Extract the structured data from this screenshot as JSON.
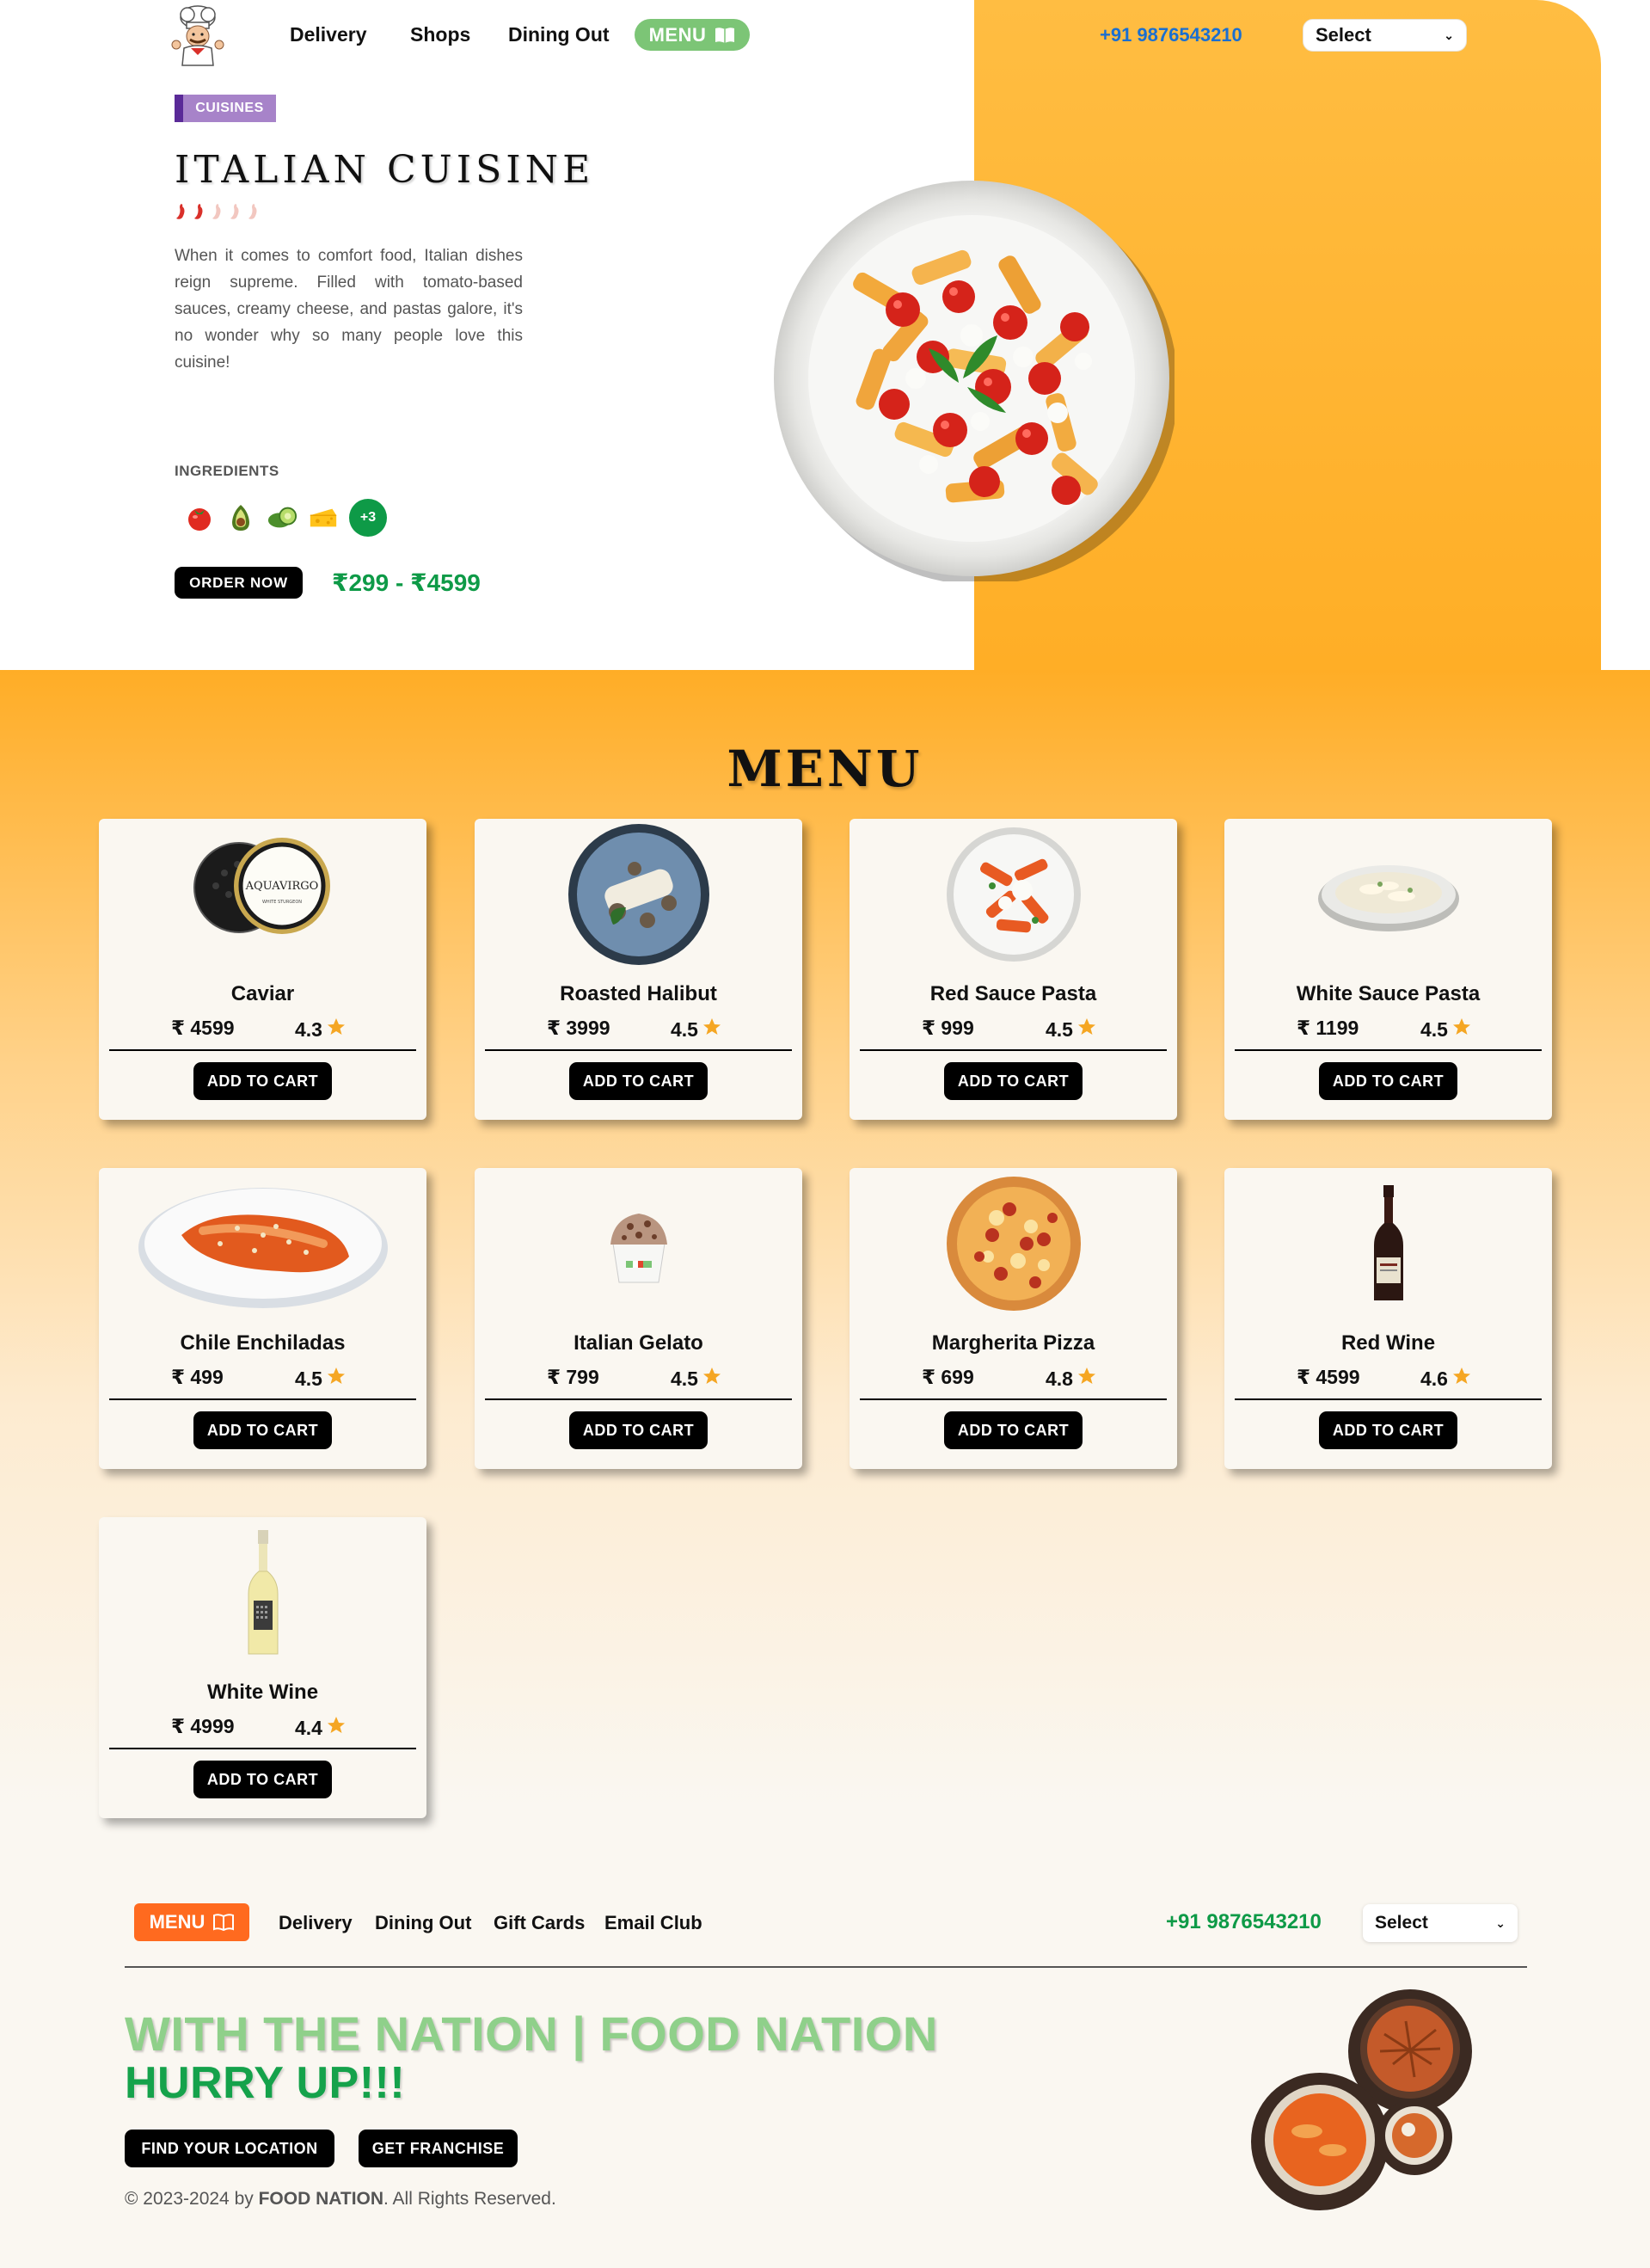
{
  "nav": {
    "links": [
      "Delivery",
      "Shops",
      "Dining Out"
    ],
    "menu_label": "MENU",
    "phone": "+91 9876543210",
    "select_value": "Select"
  },
  "hero": {
    "badge": "CUISINES",
    "title": "ITALIAN CUISINE",
    "spice_level": 2,
    "spice_max": 5,
    "description": "When it comes to comfort food, Italian dishes reign supreme. Filled with tomato-based sauces, creamy cheese, and pastas galore, it's no wonder why so many people love this cuisine!",
    "ingredients_label": "INGREDIENTS",
    "ingredients": [
      "tomato-icon",
      "avocado-icon",
      "cucumber-icon",
      "cheese-icon"
    ],
    "more_ingredients": "+3",
    "order_label": "ORDER NOW",
    "price_range": "₹299 - ₹4599"
  },
  "menu": {
    "title": "MENU",
    "add_label": "ADD TO CART",
    "items": [
      {
        "name": "Caviar",
        "price": "₹ 4599",
        "rating": "4.3"
      },
      {
        "name": "Roasted Halibut",
        "price": "₹ 3999",
        "rating": "4.5"
      },
      {
        "name": "Red Sauce Pasta",
        "price": "₹ 999",
        "rating": "4.5"
      },
      {
        "name": "White Sauce Pasta",
        "price": "₹ 1199",
        "rating": "4.5"
      },
      {
        "name": "Chile Enchiladas",
        "price": "₹ 499",
        "rating": "4.5"
      },
      {
        "name": "Italian Gelato",
        "price": "₹ 799",
        "rating": "4.5"
      },
      {
        "name": "Margherita Pizza",
        "price": "₹ 699",
        "rating": "4.8"
      },
      {
        "name": "Red Wine",
        "price": "₹ 4599",
        "rating": "4.6"
      },
      {
        "name": "White Wine",
        "price": "₹ 4999",
        "rating": "4.4"
      }
    ]
  },
  "footer": {
    "menu_label": "MENU",
    "links": [
      "Delivery",
      "Dining Out",
      "Gift Cards",
      "Email Club"
    ],
    "phone": "+91 9876543210",
    "select_value": "Select",
    "slogan_1": "WITH THE NATION | FOOD NATION",
    "slogan_2": "HURRY UP!!!",
    "btn_location": "FIND YOUR LOCATION",
    "btn_franchise": "GET FRANCHISE",
    "copyright_prefix": "© 2023-2024 by ",
    "copyright_brand": "FOOD NATION",
    "copyright_suffix": ". All Rights Reserved."
  },
  "colors": {
    "accent_orange": "#ffae26",
    "green": "#0e9a47",
    "light_green": "#7cc576",
    "footer_menu": "#ff6a1f",
    "phone_blue": "#1a6fd1"
  }
}
